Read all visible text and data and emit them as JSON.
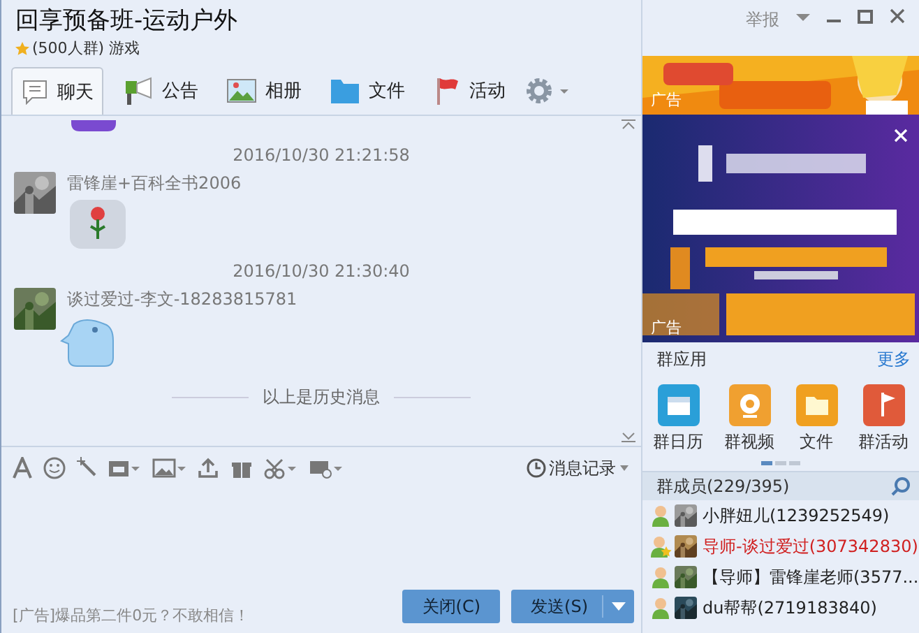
{
  "window": {
    "title": "回享预备班-运动户外",
    "subtitle": "(500人群) 游戏",
    "report": "举报"
  },
  "tabs": [
    {
      "label": "聊天",
      "selected": true
    },
    {
      "label": "公告",
      "selected": false
    },
    {
      "label": "相册",
      "selected": false
    },
    {
      "label": "文件",
      "selected": false
    },
    {
      "label": "活动",
      "selected": false
    }
  ],
  "chat": [
    {
      "kind": "cut_sticker"
    },
    {
      "kind": "timestamp",
      "text": "2016/10/30 21:21:58"
    },
    {
      "kind": "rose",
      "sender": "雷锋崖+百科全书2006"
    },
    {
      "kind": "timestamp",
      "text": "2016/10/30 21:30:40"
    },
    {
      "kind": "sticker",
      "sender": "谈过爱过-李文-18283815781"
    },
    {
      "kind": "divider",
      "text": "以上是历史消息"
    }
  ],
  "toolbar": {
    "history": "消息记录"
  },
  "input_ad": "[广告]爆品第二件0元？不敢相信！",
  "buttons": {
    "close": "关闭(C)",
    "send": "发送(S)"
  },
  "ads": [
    {
      "kind": "banner",
      "label": "广告"
    },
    {
      "kind": "large",
      "label": "广告"
    }
  ],
  "apps": {
    "title": "群应用",
    "more": "更多",
    "items": [
      {
        "label": "群日历",
        "color": "#2a9fd8"
      },
      {
        "label": "群视频",
        "color": "#f0a030"
      },
      {
        "label": "文件",
        "color": "#f0a020"
      },
      {
        "label": "群活动",
        "color": "#e05a3a"
      }
    ],
    "pages": [
      {
        "selected": true
      },
      {
        "selected": false
      },
      {
        "selected": false
      }
    ]
  },
  "members": {
    "title": "群成员(229/395)",
    "items": [
      {
        "name": "小胖妞儿(1239252549)",
        "kind": "member",
        "highlighted": false
      },
      {
        "name": "导师-谈过爱过(307342830)",
        "kind": "owner",
        "highlighted": true
      },
      {
        "name": "【导师】雷锋崖老师(3577...",
        "kind": "member",
        "highlighted": false
      },
      {
        "name": "du帮帮(2719183840)",
        "kind": "member",
        "highlighted": false
      }
    ]
  }
}
